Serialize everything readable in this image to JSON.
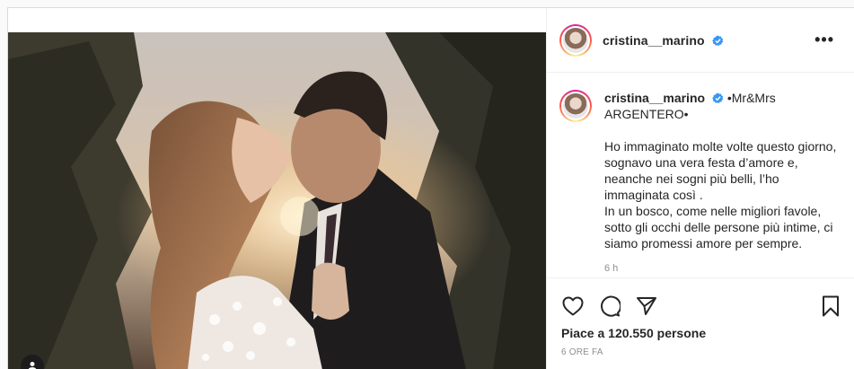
{
  "post": {
    "username": "cristina__marino",
    "more_label": "•••",
    "caption": {
      "username": "cristina__marino",
      "title": "•Mr&Mrs ARGENTERO•",
      "lines": [
        "Ho immaginato molte volte questo giorno, sognavo una vera festa d’amore e, neanche nei sogni più belli, l’ho immaginata così .",
        "In un bosco, come nelle migliori favole, sotto gli occhi delle persone più intime, ci siamo promessi amore per sempre."
      ],
      "timestamp": "6 h"
    },
    "likes": "Piace a 120.550 persone",
    "time_ago": "6 ORE FA",
    "icons": {
      "like": "heart-icon",
      "comment": "comment-icon",
      "share": "paper-plane-icon",
      "save": "bookmark-icon",
      "verified": "verified-badge-icon",
      "tag": "user-tag-icon"
    },
    "colors": {
      "verified": "#3897f0",
      "border": "#dbdbdb",
      "muted": "#8e8e8e",
      "text": "#262626"
    }
  }
}
